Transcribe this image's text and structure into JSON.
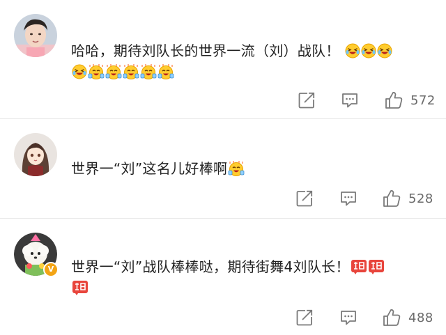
{
  "comments": [
    {
      "text": "哈哈，期待刘队长的世界一流（刘）战队！",
      "line2": "",
      "likes": "572",
      "avatar": "avatar-young-man"
    },
    {
      "text": "世界一“刘”这名儿好棒啊",
      "line2": "",
      "likes": "528",
      "avatar": "avatar-illustrated-girl"
    },
    {
      "text": "世界一“刘”战队棒棒哒，期待街舞4刘队长！",
      "line2": "",
      "likes": "488",
      "avatar": "avatar-white-dog-verified"
    }
  ],
  "icons": {
    "share": "share-icon",
    "comment": "comment-icon",
    "like": "thumbs-up-icon",
    "emoji_laugh": "laughing-emoji",
    "emoji_clap": "clapping-emoji",
    "badge_refuel": "jiayou-badge",
    "verified": "verified-badge-icon"
  },
  "colors": {
    "icon_gray": "#7a7a7a",
    "divider": "#e9e9e9",
    "verified": "#f3a415",
    "badge_red": "#e8453c"
  }
}
